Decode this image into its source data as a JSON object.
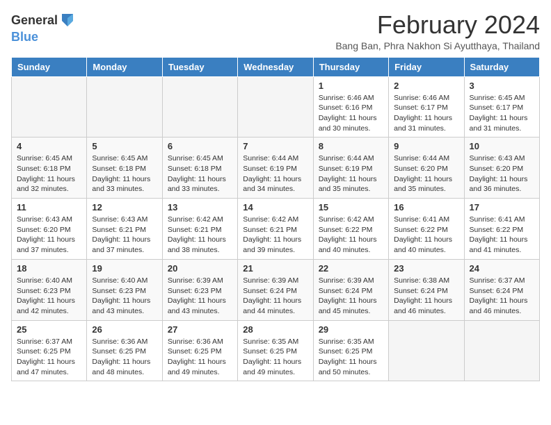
{
  "header": {
    "logo_general": "General",
    "logo_blue": "Blue",
    "title": "February 2024",
    "subtitle": "Bang Ban, Phra Nakhon Si Ayutthaya, Thailand"
  },
  "days_of_week": [
    "Sunday",
    "Monday",
    "Tuesday",
    "Wednesday",
    "Thursday",
    "Friday",
    "Saturday"
  ],
  "weeks": [
    [
      {
        "day": "",
        "info": "",
        "empty": true
      },
      {
        "day": "",
        "info": "",
        "empty": true
      },
      {
        "day": "",
        "info": "",
        "empty": true
      },
      {
        "day": "",
        "info": "",
        "empty": true
      },
      {
        "day": "1",
        "info": "Sunrise: 6:46 AM\nSunset: 6:16 PM\nDaylight: 11 hours and 30 minutes."
      },
      {
        "day": "2",
        "info": "Sunrise: 6:46 AM\nSunset: 6:17 PM\nDaylight: 11 hours and 31 minutes."
      },
      {
        "day": "3",
        "info": "Sunrise: 6:45 AM\nSunset: 6:17 PM\nDaylight: 11 hours and 31 minutes."
      }
    ],
    [
      {
        "day": "4",
        "info": "Sunrise: 6:45 AM\nSunset: 6:18 PM\nDaylight: 11 hours and 32 minutes."
      },
      {
        "day": "5",
        "info": "Sunrise: 6:45 AM\nSunset: 6:18 PM\nDaylight: 11 hours and 33 minutes."
      },
      {
        "day": "6",
        "info": "Sunrise: 6:45 AM\nSunset: 6:18 PM\nDaylight: 11 hours and 33 minutes."
      },
      {
        "day": "7",
        "info": "Sunrise: 6:44 AM\nSunset: 6:19 PM\nDaylight: 11 hours and 34 minutes."
      },
      {
        "day": "8",
        "info": "Sunrise: 6:44 AM\nSunset: 6:19 PM\nDaylight: 11 hours and 35 minutes."
      },
      {
        "day": "9",
        "info": "Sunrise: 6:44 AM\nSunset: 6:20 PM\nDaylight: 11 hours and 35 minutes."
      },
      {
        "day": "10",
        "info": "Sunrise: 6:43 AM\nSunset: 6:20 PM\nDaylight: 11 hours and 36 minutes."
      }
    ],
    [
      {
        "day": "11",
        "info": "Sunrise: 6:43 AM\nSunset: 6:20 PM\nDaylight: 11 hours and 37 minutes."
      },
      {
        "day": "12",
        "info": "Sunrise: 6:43 AM\nSunset: 6:21 PM\nDaylight: 11 hours and 37 minutes."
      },
      {
        "day": "13",
        "info": "Sunrise: 6:42 AM\nSunset: 6:21 PM\nDaylight: 11 hours and 38 minutes."
      },
      {
        "day": "14",
        "info": "Sunrise: 6:42 AM\nSunset: 6:21 PM\nDaylight: 11 hours and 39 minutes."
      },
      {
        "day": "15",
        "info": "Sunrise: 6:42 AM\nSunset: 6:22 PM\nDaylight: 11 hours and 40 minutes."
      },
      {
        "day": "16",
        "info": "Sunrise: 6:41 AM\nSunset: 6:22 PM\nDaylight: 11 hours and 40 minutes."
      },
      {
        "day": "17",
        "info": "Sunrise: 6:41 AM\nSunset: 6:22 PM\nDaylight: 11 hours and 41 minutes."
      }
    ],
    [
      {
        "day": "18",
        "info": "Sunrise: 6:40 AM\nSunset: 6:23 PM\nDaylight: 11 hours and 42 minutes."
      },
      {
        "day": "19",
        "info": "Sunrise: 6:40 AM\nSunset: 6:23 PM\nDaylight: 11 hours and 43 minutes."
      },
      {
        "day": "20",
        "info": "Sunrise: 6:39 AM\nSunset: 6:23 PM\nDaylight: 11 hours and 43 minutes."
      },
      {
        "day": "21",
        "info": "Sunrise: 6:39 AM\nSunset: 6:24 PM\nDaylight: 11 hours and 44 minutes."
      },
      {
        "day": "22",
        "info": "Sunrise: 6:39 AM\nSunset: 6:24 PM\nDaylight: 11 hours and 45 minutes."
      },
      {
        "day": "23",
        "info": "Sunrise: 6:38 AM\nSunset: 6:24 PM\nDaylight: 11 hours and 46 minutes."
      },
      {
        "day": "24",
        "info": "Sunrise: 6:37 AM\nSunset: 6:24 PM\nDaylight: 11 hours and 46 minutes."
      }
    ],
    [
      {
        "day": "25",
        "info": "Sunrise: 6:37 AM\nSunset: 6:25 PM\nDaylight: 11 hours and 47 minutes."
      },
      {
        "day": "26",
        "info": "Sunrise: 6:36 AM\nSunset: 6:25 PM\nDaylight: 11 hours and 48 minutes."
      },
      {
        "day": "27",
        "info": "Sunrise: 6:36 AM\nSunset: 6:25 PM\nDaylight: 11 hours and 49 minutes."
      },
      {
        "day": "28",
        "info": "Sunrise: 6:35 AM\nSunset: 6:25 PM\nDaylight: 11 hours and 49 minutes."
      },
      {
        "day": "29",
        "info": "Sunrise: 6:35 AM\nSunset: 6:25 PM\nDaylight: 11 hours and 50 minutes."
      },
      {
        "day": "",
        "info": "",
        "empty": true
      },
      {
        "day": "",
        "info": "",
        "empty": true
      }
    ]
  ]
}
